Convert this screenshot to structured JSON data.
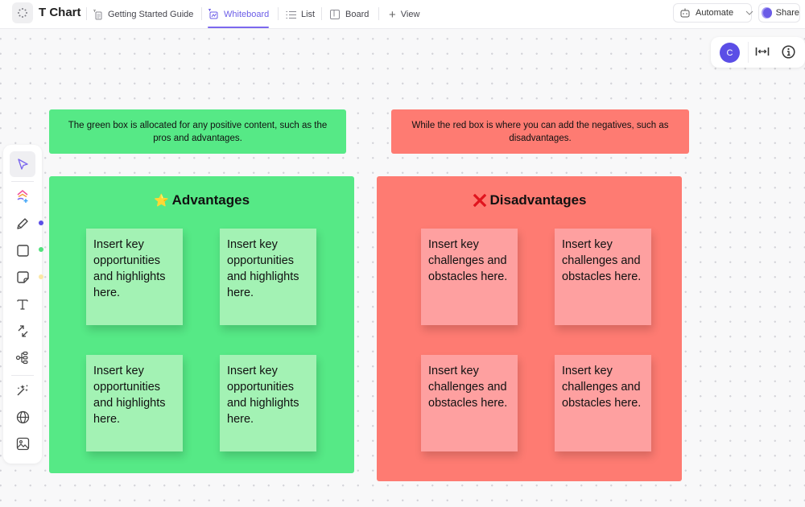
{
  "header": {
    "title": "T Chart",
    "tabs": [
      {
        "label": "Getting Started Guide",
        "icon": "doc-icon",
        "active": false
      },
      {
        "label": "Whiteboard",
        "icon": "whiteboard-icon",
        "active": true
      },
      {
        "label": "List",
        "icon": "list-icon",
        "active": false
      },
      {
        "label": "Board",
        "icon": "board-icon",
        "active": false
      }
    ],
    "add_view_label": "View",
    "automate_label": "Automate",
    "share_label": "Share"
  },
  "float_panel": {
    "avatar_initial": "C"
  },
  "toolbar": {
    "tools": [
      "select",
      "ai-generate",
      "pen",
      "shape",
      "sticky-note",
      "text",
      "connector",
      "mind-map",
      "magic",
      "embed-web",
      "image"
    ],
    "active_tool": "select",
    "color_dots": [
      "#5b4ee6",
      "#52e07d",
      "#fbe7a6"
    ]
  },
  "board": {
    "colors": {
      "green": "#56e986",
      "green_sticky": "#a3f2b4",
      "red": "#fe7b72",
      "red_sticky": "#fea0a0",
      "accent": "#7b68ee"
    },
    "green_banner": "The green box is allocated for any positive content, such as the pros and advantages.",
    "red_banner": "While the red box is where you can add the negatives, such as disadvantages.",
    "advantages": {
      "emoji": "⭐",
      "title": "Advantages",
      "notes": [
        "Insert key opportunities and highlights here.",
        "Insert key opportunities and highlights here.",
        "Insert key opportunities and highlights here.",
        "Insert key opportunities and highlights here."
      ]
    },
    "disadvantages": {
      "emoji": "❌",
      "title": "Disadvantages",
      "notes": [
        "Insert key challenges and obstacles here.",
        "Insert key challenges and obstacles here.",
        "Insert key challenges and obstacles here.",
        "Insert key challenges and obstacles here."
      ]
    }
  }
}
